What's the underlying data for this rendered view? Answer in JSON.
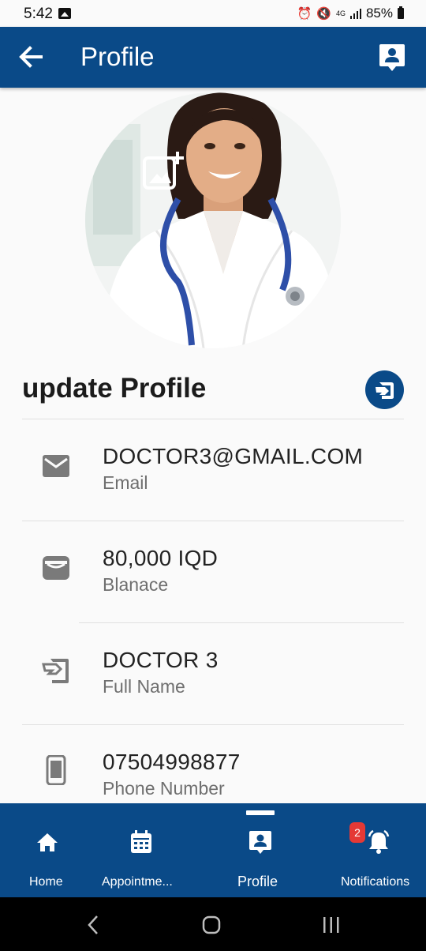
{
  "status_bar": {
    "time": "5:42",
    "network": "4G",
    "battery": "85%",
    "icons": [
      "gallery-icon",
      "alarm-icon",
      "mute-icon",
      "signal-icon",
      "battery-icon"
    ]
  },
  "app_bar": {
    "title": "Profile",
    "icons": [
      "back-arrow-icon",
      "contact-card-icon"
    ]
  },
  "avatar": {
    "icon": "add-photo-icon"
  },
  "update_section": {
    "title": "update Profile",
    "edit_icon": "edit-profile-icon"
  },
  "fields": [
    {
      "value": "DOCTOR3@GMAIL.COM",
      "label": "Email",
      "icon": "email-icon"
    },
    {
      "value": "80,000 IQD",
      "label": "Blanace",
      "icon": "wallet-icon"
    },
    {
      "value": "DOCTOR 3",
      "label": "Full Name",
      "icon": "edit-profile-icon"
    },
    {
      "value": "07504998877",
      "label": "Phone Number",
      "icon": "phone-icon"
    }
  ],
  "bottom_nav": {
    "items": [
      {
        "label": "Home",
        "icon": "home-icon"
      },
      {
        "label": "Appointme...",
        "icon": "calendar-icon"
      },
      {
        "label": "Profile",
        "icon": "contact-card-icon",
        "active": true
      },
      {
        "label": "Notifications",
        "icon": "bell-icon"
      }
    ],
    "notification_badge": "2"
  },
  "colors": {
    "primary": "#0a4a88",
    "background": "#fafafa",
    "badge": "#e53935"
  }
}
